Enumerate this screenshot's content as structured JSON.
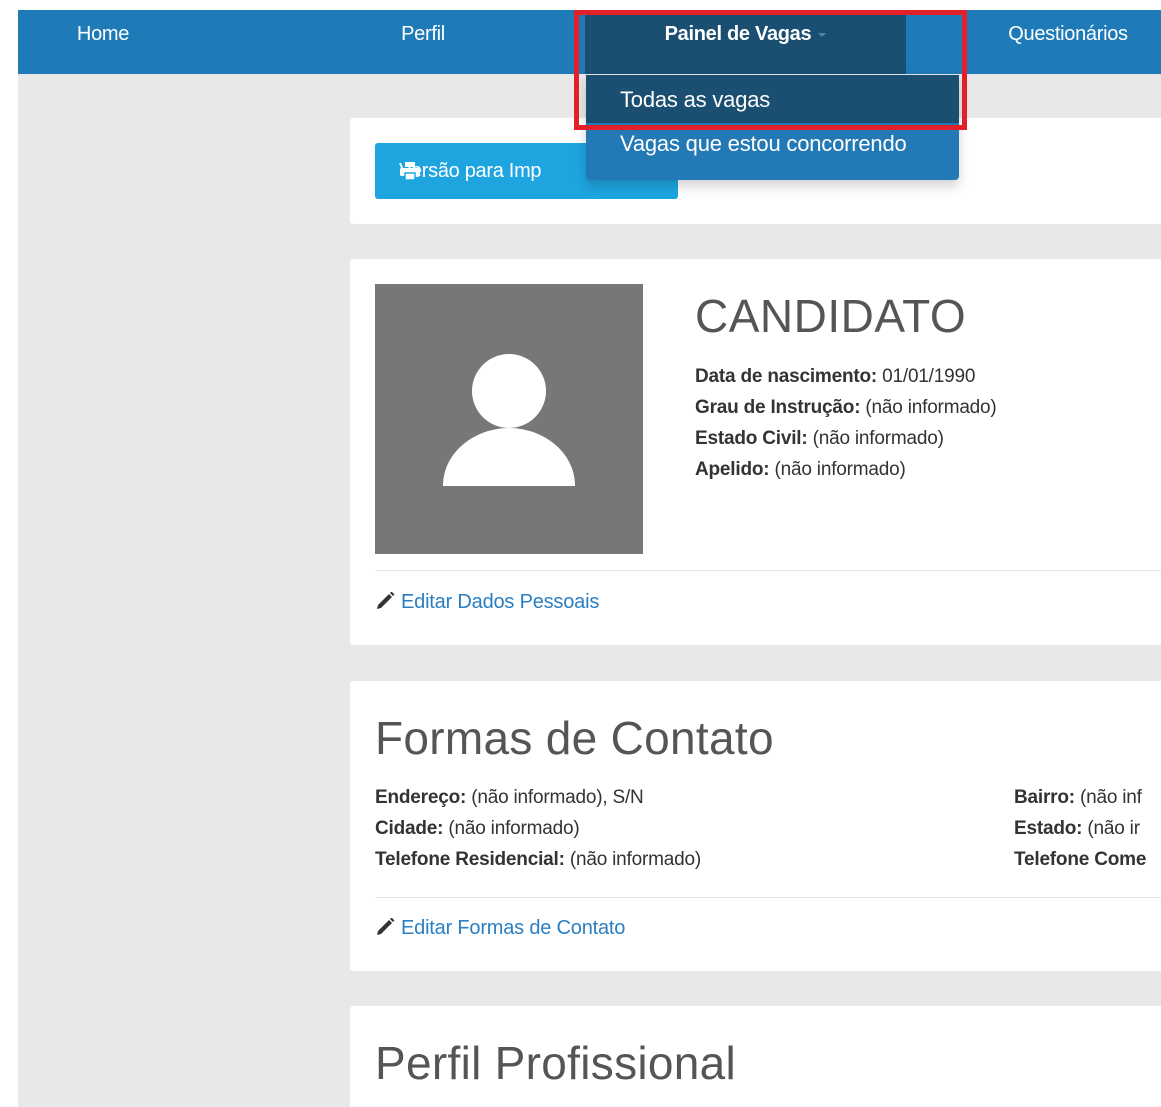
{
  "nav": {
    "home": "Home",
    "perfil": "Perfil",
    "painel": "Painel de Vagas",
    "questionarios": "Questionários"
  },
  "dropdown": {
    "items": [
      "Todas as vagas",
      "Vagas que estou concorrendo"
    ]
  },
  "print_button": {
    "label": "Versão para Imp"
  },
  "candidate": {
    "name": "CANDIDATO",
    "fields": [
      {
        "label": "Data de nascimento:",
        "value": "01/01/1990"
      },
      {
        "label": "Grau de Instrução:",
        "value": "(não informado)"
      },
      {
        "label": "Estado Civil:",
        "value": "(não informado)"
      },
      {
        "label": "Apelido:",
        "value": "(não informado)"
      }
    ],
    "edit_label": "Editar Dados Pessoais"
  },
  "contact": {
    "title": "Formas de Contato",
    "left": [
      {
        "label": "Endereço:",
        "value": "(não informado), S/N"
      },
      {
        "label": "Cidade:",
        "value": "(não informado)"
      },
      {
        "label": "Telefone Residencial:",
        "value": "(não informado)"
      }
    ],
    "right": [
      {
        "label": "Bairro:",
        "value": "(não inf"
      },
      {
        "label": "Estado:",
        "value": "(não ir"
      },
      {
        "label": "Telefone Come",
        "value": ""
      }
    ],
    "edit_label": "Editar Formas de Contato"
  },
  "profile": {
    "title": "Perfil Profissional"
  },
  "icons": {
    "printer": "printer-icon",
    "avatar": "user-avatar-icon",
    "pencil": "pencil-icon"
  },
  "colors": {
    "nav_bg": "#1e7bb8",
    "nav_active": "#1b4f72",
    "dropdown_bg": "#2379b5",
    "button_bg": "#1ea5df",
    "link": "#2a7fc3",
    "highlight": "#e1202a",
    "page_bg": "#e8e8e8"
  }
}
